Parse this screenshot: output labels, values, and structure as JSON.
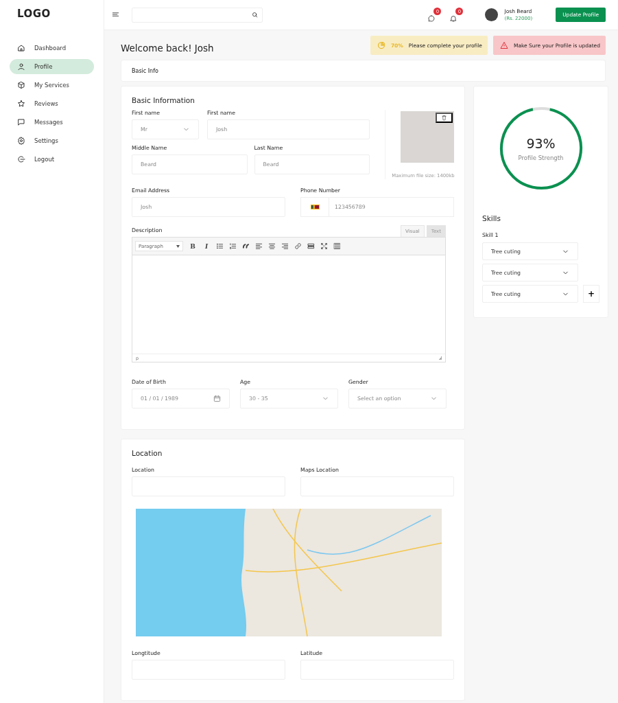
{
  "sidebar": {
    "logo": "LOGO",
    "items": [
      {
        "label": "Dashboard",
        "kind": "home",
        "selected": false
      },
      {
        "label": "Profile",
        "kind": "user",
        "selected": true
      },
      {
        "label": "My Services",
        "kind": "box",
        "selected": false
      },
      {
        "label": "Reviews",
        "kind": "star",
        "selected": false
      },
      {
        "label": "Messages",
        "kind": "message",
        "selected": false
      },
      {
        "label": "Settings",
        "kind": "gear",
        "selected": false
      },
      {
        "label": "Logout",
        "kind": "logout",
        "selected": false
      }
    ]
  },
  "topbar": {
    "notifications": [
      {
        "kind": "chat",
        "count": "0"
      },
      {
        "kind": "bell",
        "count": "0"
      }
    ],
    "user": {
      "name": "Josh Beard",
      "balance": "(Rs. 22000)"
    },
    "action": "Update Profile"
  },
  "page": {
    "title": "Welcome back! Josh",
    "alerts": [
      {
        "kind": "warning",
        "value": "70%",
        "text": "Please complete your profile"
      },
      {
        "kind": "danger",
        "text": "Make Sure your Profile is updated"
      }
    ],
    "tabs": [
      {
        "label": "Basic Info",
        "selected": true
      }
    ]
  },
  "basic_information": {
    "title": "Basic Information",
    "title_select": {
      "label": "First name",
      "placeholder": "Mr"
    },
    "first_name": {
      "label": "First name",
      "placeholder": "Josh"
    },
    "middle_name": {
      "label": "Middle Name",
      "placeholder": "Beard"
    },
    "last_name": {
      "label": "Last Name",
      "placeholder": "Beard"
    },
    "photo_note": "Maximum file size: 1400kb",
    "email": {
      "label": "Email Address",
      "placeholder": "Josh"
    },
    "phone": {
      "label": "Phone Number",
      "placeholder": "123456789"
    },
    "description": {
      "label": "Description",
      "tabs": [
        {
          "label": "Visual",
          "selected": true
        },
        {
          "label": "Text",
          "selected": false
        }
      ],
      "format": "Paragraph",
      "toolbar": [
        {
          "kind": "bold",
          "label": "B"
        },
        {
          "kind": "italic",
          "label": "I"
        },
        {
          "kind": "bullets"
        },
        {
          "kind": "numbers"
        },
        {
          "kind": "quote"
        },
        {
          "kind": "align-left"
        },
        {
          "kind": "align-center"
        },
        {
          "kind": "align-right"
        },
        {
          "kind": "link"
        },
        {
          "kind": "more"
        },
        {
          "kind": "fullscreen"
        },
        {
          "kind": "toolbar"
        }
      ],
      "path": "p"
    },
    "date_of_birth": {
      "label": "Date of Birth",
      "placeholder": "01 / 01 / 1989"
    },
    "age": {
      "label": "Age",
      "placeholder": "30 - 35"
    },
    "gender": {
      "label": "Gender",
      "placeholder": "Select an option"
    }
  },
  "profile_strength": {
    "value": "93%",
    "label": "Profile Strength",
    "level": 0.93
  },
  "skills": {
    "title": "Skills",
    "label": "Skill 1",
    "items": [
      "Tree cuting",
      "Tree cuting",
      "Tree cuting"
    ],
    "add": "+"
  },
  "location": {
    "title": "Location",
    "fields": [
      {
        "label": "Location"
      },
      {
        "label": "Maps Location"
      }
    ],
    "coords": [
      {
        "label": "Longtitude"
      },
      {
        "label": "Latitude"
      }
    ]
  }
}
